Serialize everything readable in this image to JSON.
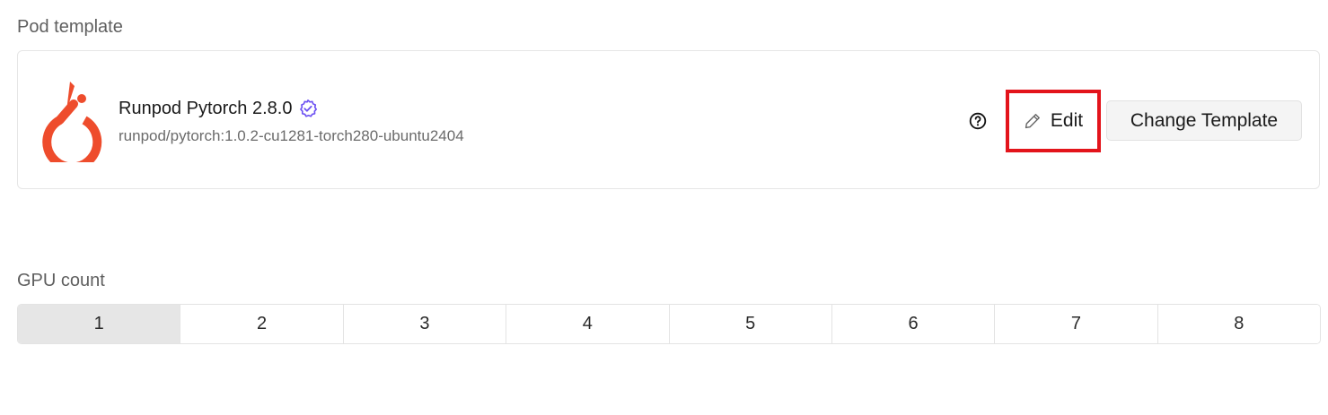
{
  "pod_template": {
    "section_label": "Pod template",
    "name": "Runpod Pytorch 2.8.0",
    "image": "runpod/pytorch:1.0.2-cu1281-torch280-ubuntu2404",
    "logo_icon": "pytorch-logo",
    "verified_icon": "verified-badge-icon",
    "help_icon": "question-circle-icon",
    "edit_label": "Edit",
    "edit_icon": "pencil-icon",
    "change_label": "Change Template",
    "colors": {
      "logo": "#ee4c2c",
      "verified": "#6d52f2",
      "highlight": "#e3141b"
    }
  },
  "gpu_count": {
    "section_label": "GPU count",
    "options": [
      "1",
      "2",
      "3",
      "4",
      "5",
      "6",
      "7",
      "8"
    ],
    "selected": "1"
  }
}
